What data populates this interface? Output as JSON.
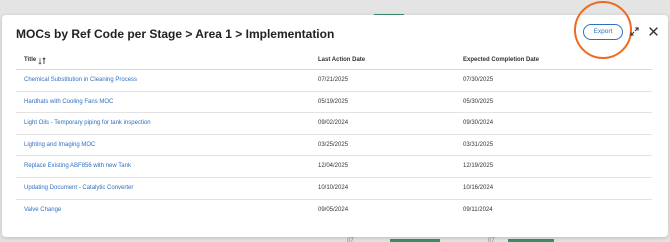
{
  "modal": {
    "title": "MOCs by Ref Code per Stage > Area 1 > Implementation",
    "export_label": "Export"
  },
  "table": {
    "columns": [
      "Title",
      "Last Action Date",
      "Expected Completion Date"
    ],
    "rows": [
      {
        "title": "Chemical Substitution in Cleaning Process",
        "last_action": "07/21/2025",
        "expected": "07/30/2025"
      },
      {
        "title": "Hardhats with Cooling Fans MOC",
        "last_action": "05/19/2025",
        "expected": "05/30/2025"
      },
      {
        "title": "Light Oils - Temporary piping for tank inspection",
        "last_action": "09/02/2024",
        "expected": "09/30/2024"
      },
      {
        "title": "Lighting and Imaging MOC",
        "last_action": "03/25/2025",
        "expected": "03/31/2025"
      },
      {
        "title": "Replace Existing ABF856 with new Tank",
        "last_action": "12/04/2025",
        "expected": "12/19/2025"
      },
      {
        "title": "Updating Document - Catalytic Converter",
        "last_action": "10/10/2024",
        "expected": "10/16/2024"
      },
      {
        "title": "Valve Change",
        "last_action": "09/05/2024",
        "expected": "09/11/2024"
      }
    ]
  },
  "backdrop": {
    "text_1": "07",
    "text_2": "07"
  },
  "colors": {
    "link": "#2f6fc0",
    "highlight": "#f06a1d",
    "accent_strip": "#3b8f6a"
  }
}
